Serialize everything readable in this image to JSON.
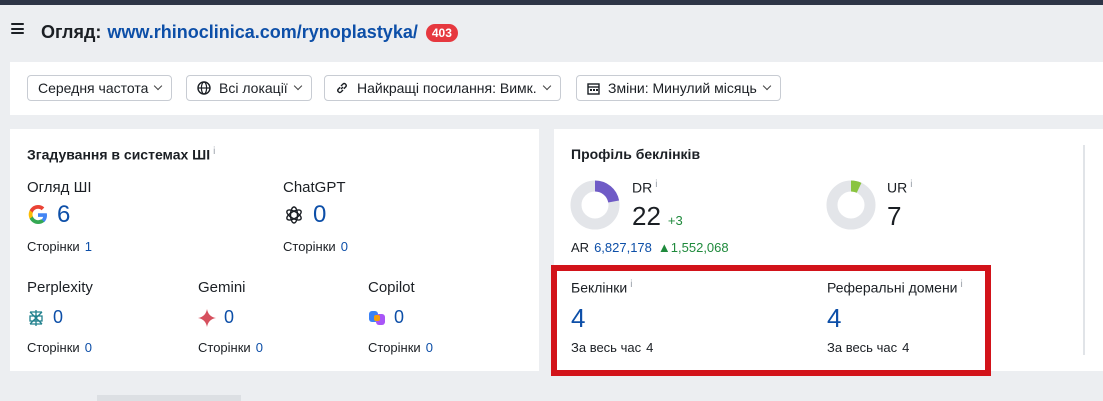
{
  "header": {
    "title_label": "Огляд:",
    "url": "www.rhinoclinica.com/rynoplastyka/",
    "badge": "403"
  },
  "filters": [
    {
      "label": "Середня частота",
      "icon": "none"
    },
    {
      "label": "Всі локації",
      "icon": "globe-icon"
    },
    {
      "label": "Найкращі посилання: Вимк.",
      "icon": "link-icon"
    },
    {
      "label": "Зміни: Минулий місяць",
      "icon": "calendar-icon"
    }
  ],
  "ai_card": {
    "title": "Згадування в системах ШІ",
    "info": "i",
    "metrics": [
      {
        "label": "Огляд ШІ",
        "value": "6",
        "sub_label": "Сторінки",
        "sub_value": "1",
        "icon": "google-icon"
      },
      {
        "label": "ChatGPT",
        "value": "0",
        "sub_label": "Сторінки",
        "sub_value": "0",
        "icon": "chatgpt-icon"
      },
      {
        "label": "Perplexity",
        "value": "0",
        "sub_label": "Сторінки",
        "sub_value": "0",
        "icon": "perplexity-icon"
      },
      {
        "label": "Gemini",
        "value": "0",
        "sub_label": "Сторінки",
        "sub_value": "0",
        "icon": "gemini-icon"
      },
      {
        "label": "Copilot",
        "value": "0",
        "sub_label": "Сторінки",
        "sub_value": "0",
        "icon": "copilot-icon"
      }
    ]
  },
  "backlink_card": {
    "title": "Профіль беклінків",
    "dr": {
      "label": "DR",
      "info": "i",
      "value": "22",
      "delta": "+3",
      "fill": 0.22
    },
    "ur": {
      "label": "UR",
      "info": "i",
      "value": "7",
      "fill": 0.07
    },
    "ar": {
      "label": "AR",
      "value": "6,827,178",
      "change": "1,552,068"
    },
    "backlinks": {
      "label": "Беклінки",
      "info": "i",
      "value": "4",
      "sub_label": "За весь час",
      "sub_value": "4"
    },
    "ref_domains": {
      "label": "Реферальні домени",
      "info": "i",
      "value": "4",
      "sub_label": "За весь час",
      "sub_value": "4"
    }
  },
  "colors": {
    "accent_link": "#0d4fa8",
    "badge": "#e6383f",
    "highlight": "#d2131a",
    "dr_fill": "#6f5bc6",
    "ur_fill": "#8ac43f",
    "positive": "#1f8a3c"
  }
}
